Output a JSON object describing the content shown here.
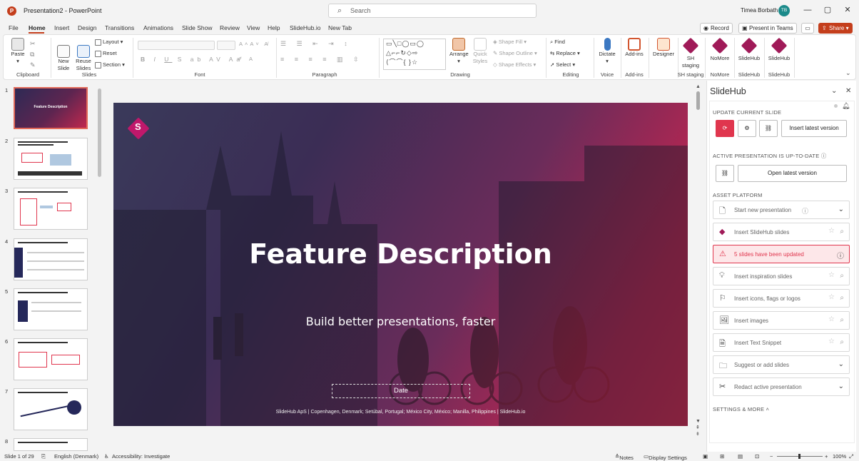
{
  "window": {
    "doc_title": "Presentation2 - PowerPoint",
    "search_placeholder": "Search",
    "user": "Timea Borbath",
    "user_initials": "TB",
    "app_icon": "P",
    "min": "—",
    "max": "▢",
    "close": "✕"
  },
  "tabs": [
    "File",
    "Home",
    "Insert",
    "Design",
    "Transitions",
    "Animations",
    "Slide Show",
    "Review",
    "View",
    "Help",
    "SlideHub.io",
    "New Tab"
  ],
  "top_buttons": {
    "record": "Record",
    "present_teams": "Present in Teams",
    "share": "Share"
  },
  "ribbon": {
    "groups": [
      "Clipboard",
      "Slides",
      "Font",
      "Paragraph",
      "Drawing",
      "Editing",
      "Voice",
      "Add-ins",
      "SH staging",
      "NoMore",
      "SlideHub",
      "SlideHub"
    ],
    "paste": "Paste",
    "new_slide": "New\nSlide",
    "reuse_slides": "Reuse\nSlides",
    "layout": "Layout",
    "reset": "Reset",
    "section": "Section",
    "arrange": "Arrange",
    "quick_styles": "Quick\nStyles",
    "shape_fill": "Shape Fill",
    "shape_outline": "Shape Outline",
    "shape_effects": "Shape Effects",
    "find": "Find",
    "replace": "Replace",
    "select": "Select",
    "dictate": "Dictate",
    "addins": "Add-ins",
    "designer": "Designer",
    "sh_staging": "SH\nstaging",
    "nomore": "NoMore",
    "slidehub1": "SlideHub",
    "slidehub2": "SlideHub"
  },
  "slides_panel": {
    "numbers": [
      "1",
      "2",
      "3",
      "4",
      "5",
      "6",
      "7",
      "8"
    ],
    "selected": 1
  },
  "slide": {
    "title": "Feature Description",
    "subtitle": "Build better presentations, faster",
    "date": "Date",
    "footer": "SlideHub ApS   |   Copenhagen, Denmark; Setúbal, Portugal; México City, México; Manilla, Philippines |   SlideHub.io",
    "logo_letter": "S"
  },
  "slidehub_panel": {
    "title": "SlideHub",
    "update_current": "UPDATE CURRENT SLIDE",
    "insert_latest": "Insert latest version",
    "active_up_to_date": "ACTIVE PRESENTATION IS UP-TO-DATE",
    "open_latest": "Open latest version",
    "asset_platform": "ASSET PLATFORM",
    "rows": [
      "Start new presentation",
      "Insert SlideHub slides",
      "5 slides have been updated",
      "Insert inspiration slides",
      "Insert icons, flags or logos",
      "Insert images",
      "Insert Text Snippet",
      "Suggest or add slides",
      "Redact active presentation"
    ],
    "settings": "SETTINGS & MORE"
  },
  "status": {
    "slide_count": "Slide 1 of 29",
    "language": "English (Denmark)",
    "accessibility": "Accessibility: Investigate",
    "notes": "Notes",
    "display_settings": "Display Settings",
    "zoom": "100%"
  },
  "colors": {
    "accent": "#c43e1c",
    "slidehub": "#a01a58",
    "alert": "#e0364e"
  }
}
